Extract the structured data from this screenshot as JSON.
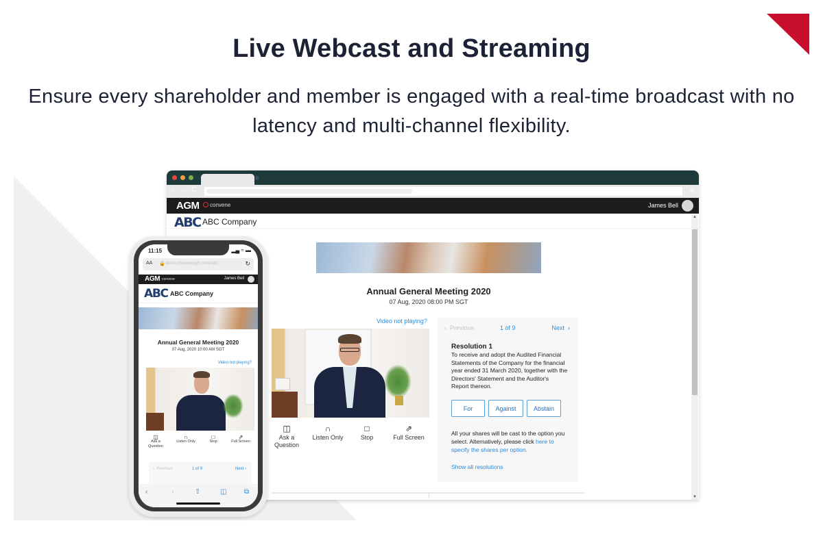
{
  "hero": {
    "title": "Live Webcast and Streaming",
    "subtitle": "Ensure every shareholder and member is engaged with a real-time broadcast with no latency and multi-channel flexibility."
  },
  "colors": {
    "brand_red": "#c8102e",
    "link_blue": "#2a8be0",
    "company_navy": "#213c6e",
    "header_dark": "#1c1c1c",
    "browser_frame": "#1f3a3a"
  },
  "desktop": {
    "app": {
      "logo": "AGM",
      "partner": "convene",
      "user_name": "James Bell"
    },
    "company": {
      "logo": "ABC",
      "name": "ABC Company"
    },
    "meeting": {
      "title": "Annual General Meeting 2020",
      "date": "07 Aug, 2020 08:00 PM SGT"
    },
    "video_help": "Video not playing?",
    "controls": [
      {
        "icon": "question-bubble-icon",
        "label": "Ask a Question"
      },
      {
        "icon": "headphones-icon",
        "label": "Listen Only"
      },
      {
        "icon": "stop-icon",
        "label": "Stop"
      },
      {
        "icon": "fullscreen-icon",
        "label": "Full Screen"
      }
    ],
    "voting": {
      "prev": "Previous",
      "pager": "1 of 9",
      "next": "Next",
      "resolution_title": "Resolution 1",
      "resolution_text": "To receive and adopt the Audited Financial Statements of the Company for the financial year ended 31 March 2020, together with the Directors' Statement and the Auditor's Report thereon.",
      "options": [
        "For",
        "Against",
        "Abstain"
      ],
      "note": "All your shares will be cast to the option you select. Alternatively, please click",
      "note_link": "here to specify the shares per option.",
      "show_all": "Show all resolutions"
    }
  },
  "mobile": {
    "time": "11:15",
    "text_size": "AA",
    "url": "demo.conveneagm.com/ABC",
    "app": {
      "logo": "AGM",
      "partner": "convene",
      "user_name": "James Bell"
    },
    "company": {
      "logo": "ABC",
      "name": "ABC Company"
    },
    "meeting": {
      "title": "Annual General Meeting 2020",
      "date": "07 Aug, 2020 10:00 AM SGT"
    },
    "video_help": "Video not playing?",
    "controls": [
      {
        "label_1": "Ask a",
        "label_2": "Question"
      },
      {
        "label_1": "Listen Only"
      },
      {
        "label_1": "Stop"
      },
      {
        "label_1": "Full Screen"
      }
    ],
    "voting": {
      "prev": "Previous",
      "pager": "1 of 9",
      "next": "Next"
    }
  }
}
